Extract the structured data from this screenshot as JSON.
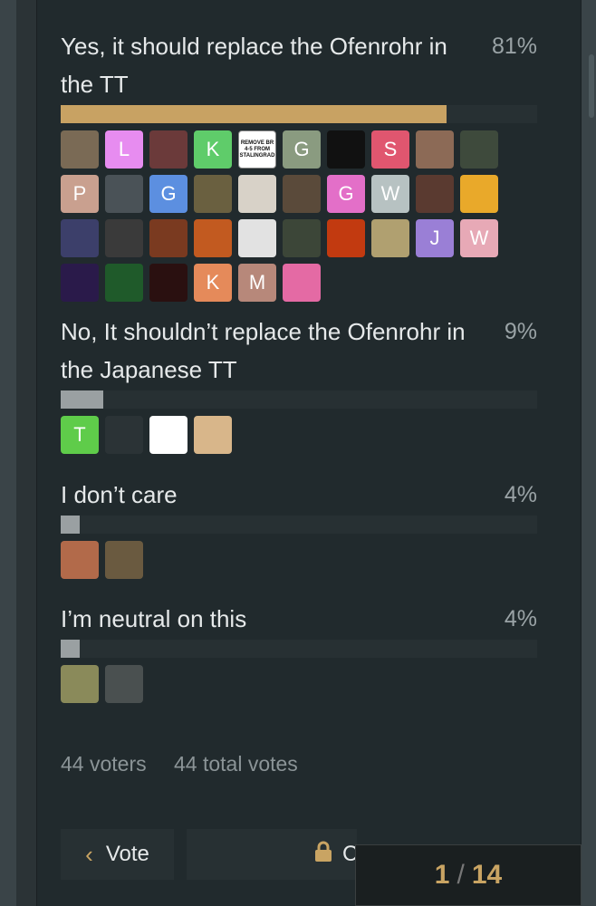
{
  "poll": {
    "options": [
      {
        "title": "Yes, it should replace the Ofenrohr in the TT",
        "percent_label": "81%",
        "percent": 81,
        "bar_color": "#c8a263",
        "avatars": [
          {
            "bg": "#7a6a55",
            "label": ""
          },
          {
            "bg": "#e78cf0",
            "label": "L"
          },
          {
            "bg": "#6b3a3a",
            "label": ""
          },
          {
            "bg": "#5fcc6a",
            "label": "K"
          },
          {
            "bg": "#ffffff",
            "label": "REMOVE BR 4-5 FROM STALINGRAD",
            "kind": "text"
          },
          {
            "bg": "#8a9b80",
            "label": "G"
          },
          {
            "bg": "#111111",
            "label": ""
          },
          {
            "bg": "#e0566f",
            "label": "S"
          },
          {
            "bg": "#8c6a56",
            "label": ""
          },
          {
            "bg": "#3e4a3c",
            "label": ""
          },
          {
            "bg": "#c9a08f",
            "label": "P"
          },
          {
            "bg": "#4a5257",
            "label": ""
          },
          {
            "bg": "#5c8fe0",
            "label": "G"
          },
          {
            "bg": "#6a6040",
            "label": ""
          },
          {
            "bg": "#d8d2c8",
            "label": ""
          },
          {
            "bg": "#5a4a3a",
            "label": ""
          },
          {
            "bg": "#e36fc8",
            "label": "G"
          },
          {
            "bg": "#b7c2c2",
            "label": "W"
          },
          {
            "bg": "#5a3a30",
            "label": ""
          },
          {
            "bg": "#e9a92a",
            "label": ""
          },
          {
            "bg": "#3c3f6a",
            "label": ""
          },
          {
            "bg": "#3a3a3a",
            "label": ""
          },
          {
            "bg": "#7a3a20",
            "label": ""
          },
          {
            "bg": "#c25a20",
            "label": ""
          },
          {
            "bg": "#e2e2e2",
            "label": ""
          },
          {
            "bg": "#3c4638",
            "label": ""
          },
          {
            "bg": "#c23a10",
            "label": ""
          },
          {
            "bg": "#b0a070",
            "label": ""
          },
          {
            "bg": "#9a7fd6",
            "label": "J"
          },
          {
            "bg": "#e7a9b6",
            "label": "W"
          },
          {
            "bg": "#2a1a4a",
            "label": ""
          },
          {
            "bg": "#1f5a2a",
            "label": ""
          },
          {
            "bg": "#2a1010",
            "label": ""
          },
          {
            "bg": "#e58a5a",
            "label": "K"
          },
          {
            "bg": "#b7887a",
            "label": "M"
          },
          {
            "bg": "#e46aa4",
            "label": ""
          }
        ]
      },
      {
        "title": "No, It shouldn’t replace the Ofenrohr in the Japanese TT",
        "percent_label": "9%",
        "percent": 9,
        "bar_color": "#9aa0a2",
        "avatars": [
          {
            "bg": "#5fcc4a",
            "label": "T"
          },
          {
            "bg": "#2b3336",
            "label": ""
          },
          {
            "bg": "#ffffff",
            "label": ""
          },
          {
            "bg": "#d8b68a",
            "label": ""
          }
        ]
      },
      {
        "title": "I don’t care",
        "percent_label": "4%",
        "percent": 4,
        "bar_color": "#9aa0a2",
        "avatars": [
          {
            "bg": "#b26a4a",
            "label": ""
          },
          {
            "bg": "#6a5a40",
            "label": ""
          }
        ]
      },
      {
        "title": "I’m neutral on this",
        "percent_label": "4%",
        "percent": 4,
        "bar_color": "#9aa0a2",
        "avatars": [
          {
            "bg": "#8a8a5a",
            "label": ""
          },
          {
            "bg": "#4a5050",
            "label": ""
          }
        ]
      }
    ],
    "voters_label": "44 voters",
    "total_votes_label": "44 total votes"
  },
  "actions": {
    "vote_label": "Vote",
    "lock_label": "C"
  },
  "pager": {
    "current": "1",
    "separator": "/",
    "total": "14"
  },
  "colors": {
    "accent": "#c8a263",
    "panel": "#212a2d"
  }
}
